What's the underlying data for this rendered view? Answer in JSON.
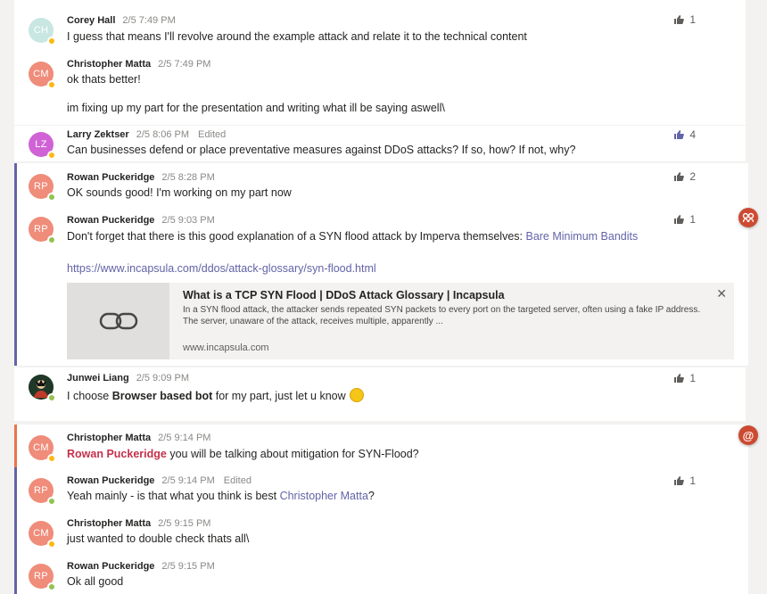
{
  "messages": {
    "m1": {
      "initials": "CH",
      "author": "Corey Hall",
      "time": "2/5 7:49 PM",
      "text": "I guess that means I'll revolve around the example attack and relate it to the technical content",
      "likes": "1"
    },
    "m2": {
      "initials": "CM",
      "author": "Christopher Matta",
      "time": "2/5 7:49 PM",
      "text": "ok thats better!",
      "text2": "im fixing up my part for the presentation and writing what ill be saying aswell\\"
    },
    "m3": {
      "initials": "LZ",
      "author": "Larry Zektser",
      "time": "2/5 8:06 PM",
      "edited": "Edited",
      "text": "Can businesses defend or place preventative measures against DDoS attacks? If so, how? If not, why?",
      "likes": "4"
    },
    "m4": {
      "initials": "RP",
      "author": "Rowan Puckeridge",
      "time": "2/5 8:28 PM",
      "text": "OK sounds good! I'm working on my part now",
      "likes": "2"
    },
    "m5": {
      "initials": "RP",
      "author": "Rowan Puckeridge",
      "time": "2/5 9:03 PM",
      "text": "Don't forget that there is this good explanation of a SYN flood attack by Imperva themselves: ",
      "link_text": "Bare Minimum Bandits",
      "url": "https://www.incapsula.com/ddos/attack-glossary/syn-flood.html",
      "likes": "1",
      "preview": {
        "title": "What is a TCP SYN Flood | DDoS Attack Glossary | Incapsula",
        "desc": "In a SYN flood attack, the attacker sends repeated SYN packets to every port on the targeted server, often using a fake IP address. The server, unaware of the attack, receives multiple, apparently ...",
        "domain": "www.incapsula.com"
      }
    },
    "m6": {
      "author": "Junwei Liang",
      "time": "2/5 9:09 PM",
      "text_pre": "I choose ",
      "text_bold": "Browser based bot",
      "text_post": " for my part, just let u know",
      "likes": "1"
    },
    "m7": {
      "initials": "CM",
      "author": "Christopher Matta",
      "time": "2/5 9:14 PM",
      "mention": "Rowan Puckeridge",
      "text": " you will be talking about mitigation for SYN-Flood?"
    },
    "m8": {
      "initials": "RP",
      "author": "Rowan Puckeridge",
      "time": "2/5 9:14 PM",
      "edited": "Edited",
      "text": "Yeah mainly - is that what you think is best ",
      "link_text": "Christopher Matta",
      "text_post": "?",
      "likes": "1"
    },
    "m9": {
      "initials": "CM",
      "author": "Christopher Matta",
      "time": "2/5 9:15 PM",
      "text": "just wanted to double check thats all\\"
    },
    "m10": {
      "initials": "RP",
      "author": "Rowan Puckeridge",
      "time": "2/5 9:15 PM",
      "text": "Ok all good"
    }
  },
  "side_badges": {
    "app_icon": "app-icon",
    "mention_icon": "@"
  },
  "colors": {
    "accent": "#6264a7",
    "mention": "#cc4a31",
    "away": "#fdb913",
    "available": "#92c353"
  }
}
